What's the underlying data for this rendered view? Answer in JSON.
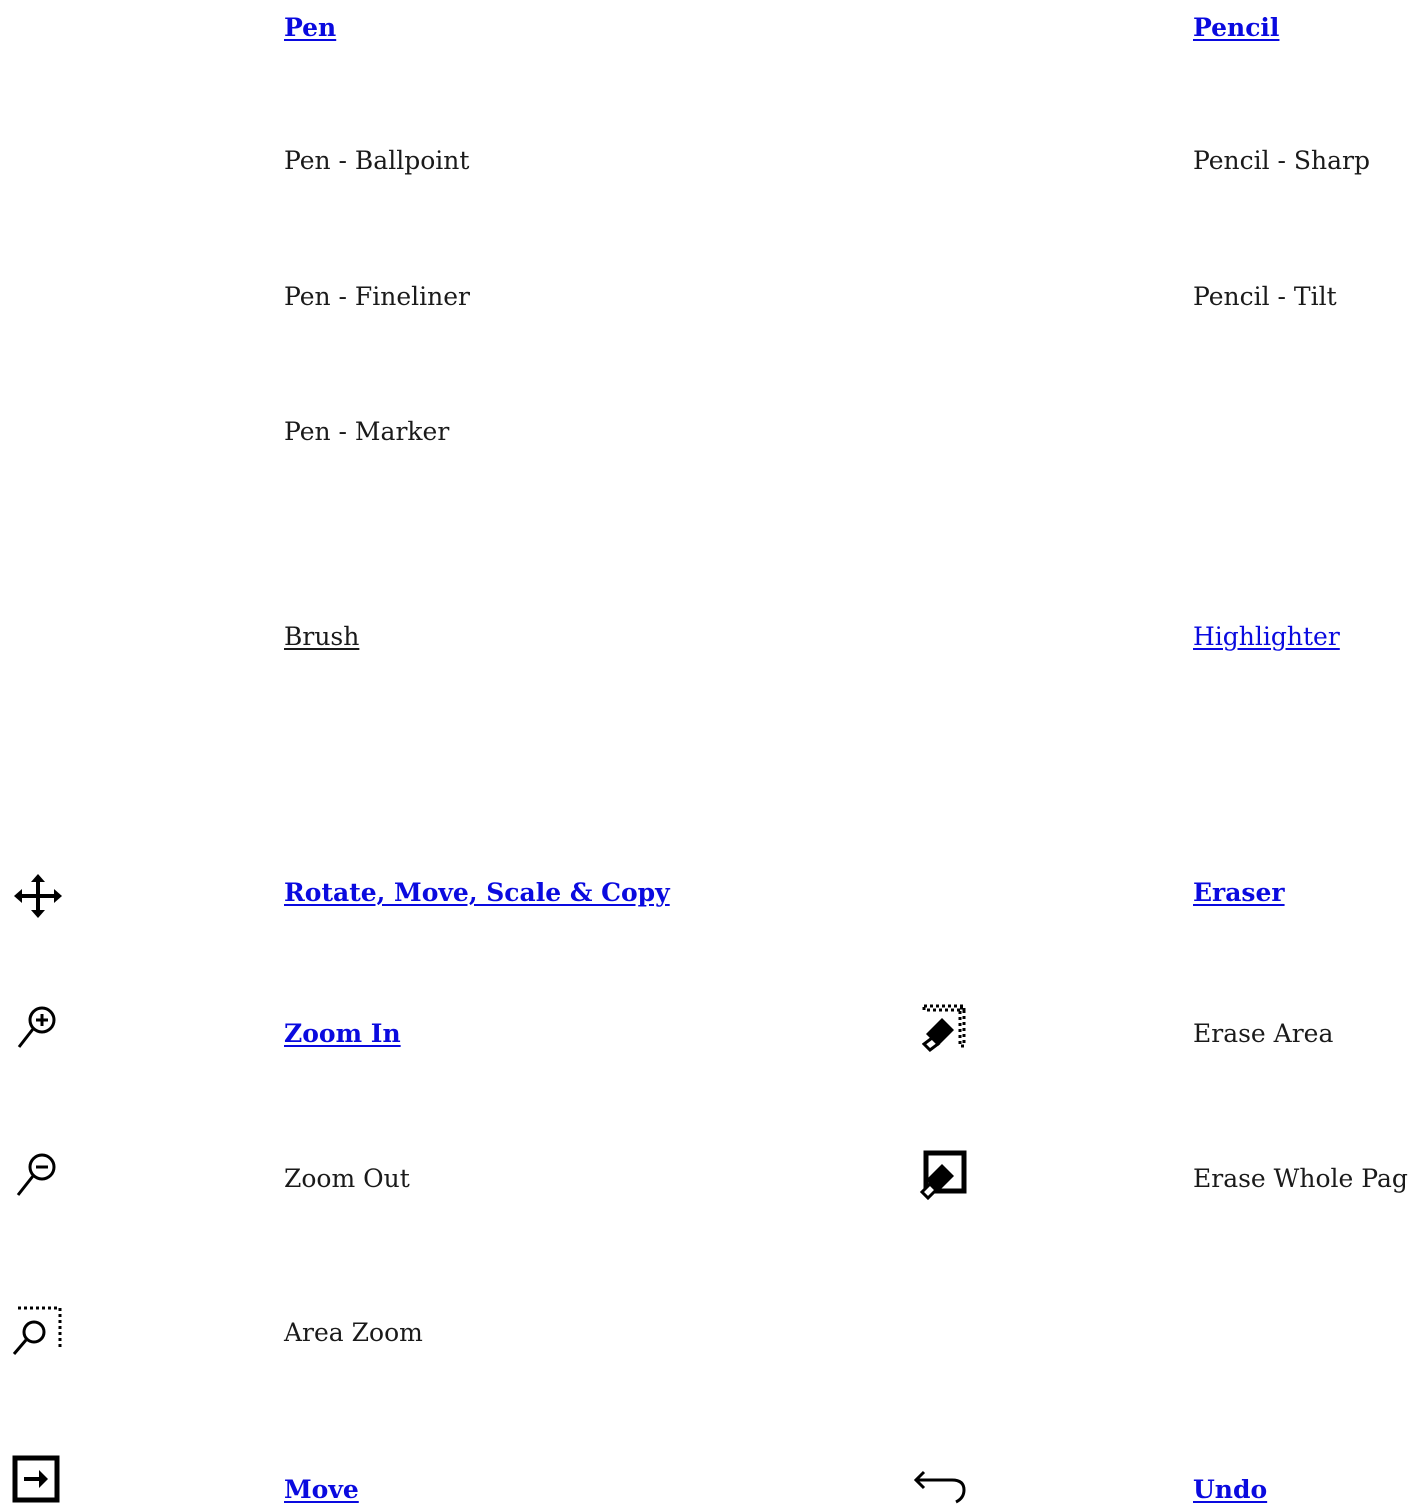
{
  "pen": {
    "heading": "Pen",
    "items": [
      "Pen - Ballpoint",
      "Pen - Fineliner",
      "Pen - Marker"
    ],
    "brush": "Brush"
  },
  "pencil": {
    "heading": "Pencil",
    "items": [
      "Pencil - Sharp",
      "Pencil - Tilt"
    ],
    "highlighter": "Highlighter"
  },
  "transform": {
    "rotate_move": "Rotate, Move, Scale & Copy",
    "zoom_in": "Zoom In",
    "zoom_out": "Zoom Out",
    "area_zoom": "Area Zoom",
    "move": "Move"
  },
  "eraser": {
    "heading": "Eraser",
    "erase_area": "Erase Area",
    "erase_whole_page": "Erase Whole Page"
  },
  "undo": {
    "label": "Undo"
  },
  "colors": {
    "link": "#0a0adf",
    "text": "#1a1a1a",
    "icon": "#000000"
  },
  "icons": {
    "move_arrows": "move-arrows-icon",
    "zoom_in": "zoom-in-icon",
    "zoom_out": "zoom-out-icon",
    "area_zoom": "area-zoom-icon",
    "move_page": "move-page-icon",
    "erase_area": "erase-area-icon",
    "erase_page": "erase-page-icon",
    "undo": "undo-icon"
  }
}
